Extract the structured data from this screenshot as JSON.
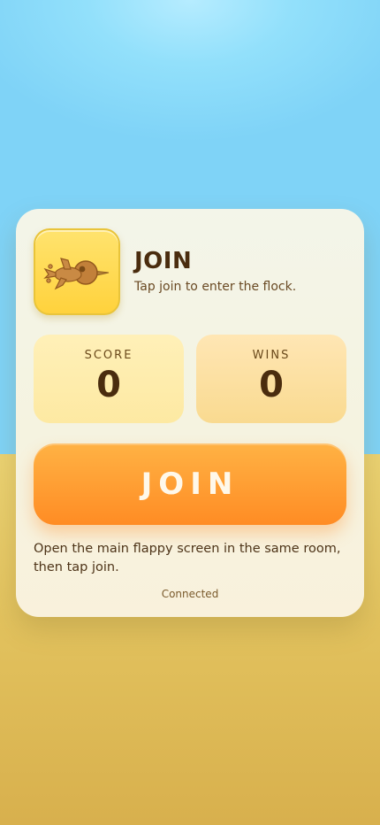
{
  "header": {
    "title": "JOIN",
    "subtitle": "Tap join to enter the flock."
  },
  "avatar": {
    "icon": "bird-icon"
  },
  "stats": {
    "score": {
      "label": "SCORE",
      "value": "0"
    },
    "wins": {
      "label": "WINS",
      "value": "0"
    }
  },
  "join_button": {
    "label": "JOIN"
  },
  "hint": "Open the main flappy screen in the same room, then tap join.",
  "status": "Connected",
  "colors": {
    "sky": "#8fdcf9",
    "ground": "#e2c25e",
    "card": "#f5f3e0",
    "avatar_tile": "#ffd84a",
    "join_button": "#ff9a30",
    "text_dark": "#4a2c0e"
  }
}
